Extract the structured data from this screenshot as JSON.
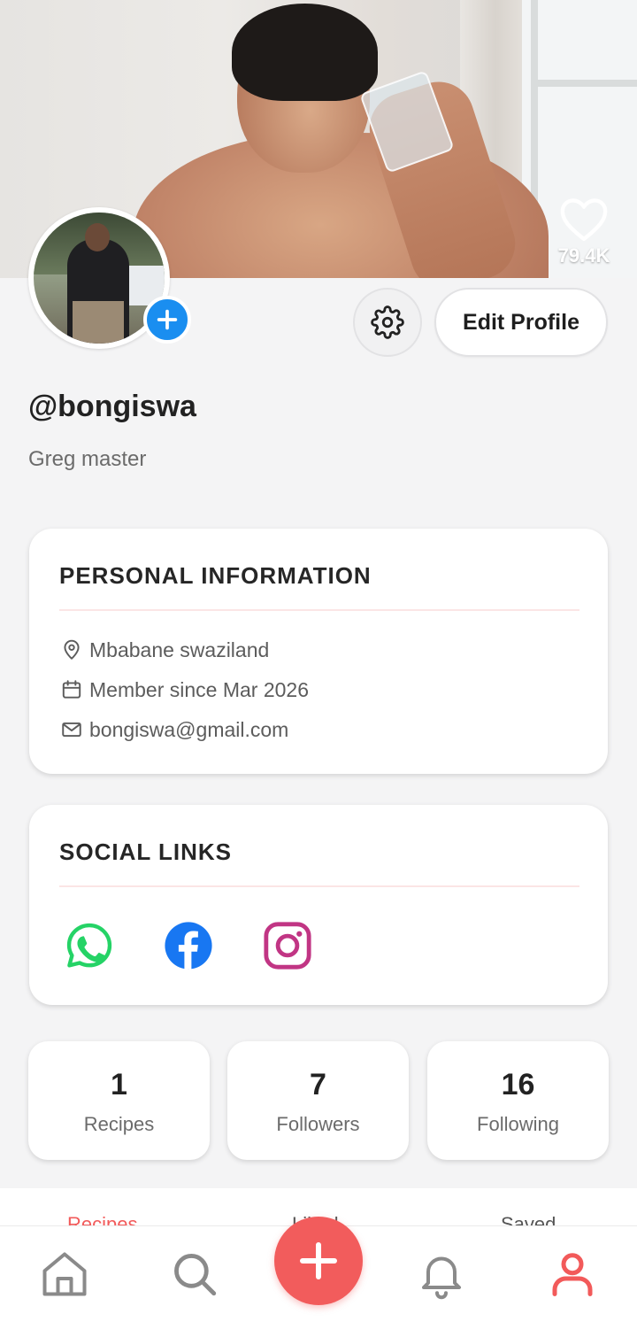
{
  "cover": {
    "like_count": "79.4K"
  },
  "profile": {
    "username": "@bongiswa",
    "bio": "Greg master",
    "edit_label": "Edit Profile"
  },
  "personal_info": {
    "title": "PERSONAL INFORMATION",
    "location": "Mbabane swaziland",
    "member_since": "Member since Mar 2026",
    "email": "bongiswa@gmail.com"
  },
  "social_links": {
    "title": "SOCIAL LINKS",
    "items": [
      "whatsapp-icon",
      "facebook-icon",
      "instagram-icon"
    ]
  },
  "stats": [
    {
      "value": "1",
      "label": "Recipes"
    },
    {
      "value": "7",
      "label": "Followers"
    },
    {
      "value": "16",
      "label": "Following"
    }
  ],
  "tabs": [
    {
      "label": "Recipes",
      "active": true
    },
    {
      "label": "Liked",
      "active": false
    },
    {
      "label": "Saved",
      "active": false
    }
  ],
  "nav": [
    "home-icon",
    "search-icon",
    "add-icon",
    "bell-icon",
    "profile-icon"
  ],
  "colors": {
    "accent": "#f25a5a",
    "badge_blue": "#1a8ef0",
    "whatsapp": "#25d366",
    "facebook": "#1877f2",
    "instagram": "#c13584"
  }
}
